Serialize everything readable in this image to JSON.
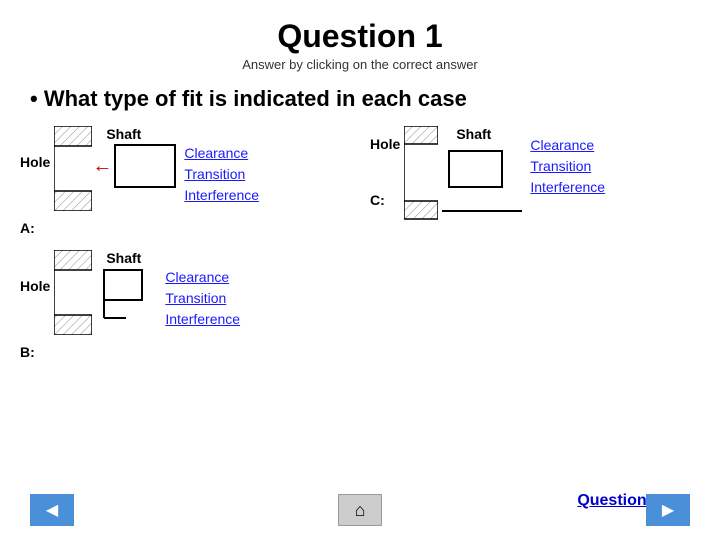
{
  "title": "Question 1",
  "subtitle": "Answer by clicking on the correct answer",
  "question": "• What type of fit is indicated in each case",
  "diagrams": {
    "hole_label": "Hole",
    "shaft_label": "Shaft",
    "a_label": "A:",
    "b_label": "B:",
    "c_label": "C:"
  },
  "answers": {
    "clearance": "Clearance",
    "transition": "Transition",
    "interference": "Interference"
  },
  "nav": {
    "back_label": "◀",
    "home_label": "⌂",
    "forward_label": "▶",
    "question2": "Question 2"
  }
}
